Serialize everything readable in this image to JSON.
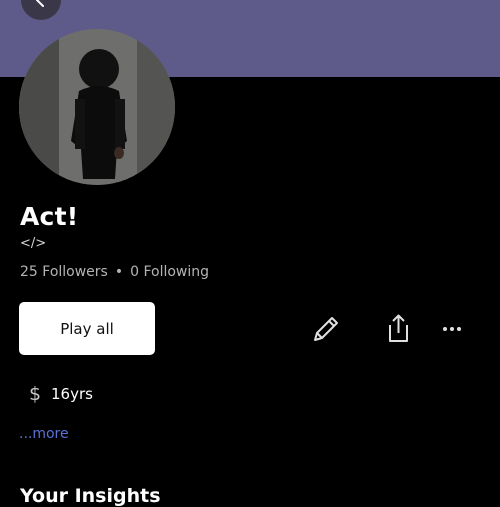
{
  "header": {
    "accent_color": "#5e5a8a",
    "back_icon": "chevron-left-icon"
  },
  "profile": {
    "name": "Act!",
    "handle": "</>",
    "followers": "25 Followers",
    "separator": "•",
    "following": "0 Following"
  },
  "actions": {
    "play_all_label": "Play all",
    "edit_icon": "pencil-icon",
    "share_icon": "share-icon",
    "more_icon": "ellipsis-icon"
  },
  "details": {
    "price_symbol": "$",
    "price_text": "16yrs",
    "more_link": "...more"
  },
  "insights": {
    "heading": "Your Insights"
  }
}
